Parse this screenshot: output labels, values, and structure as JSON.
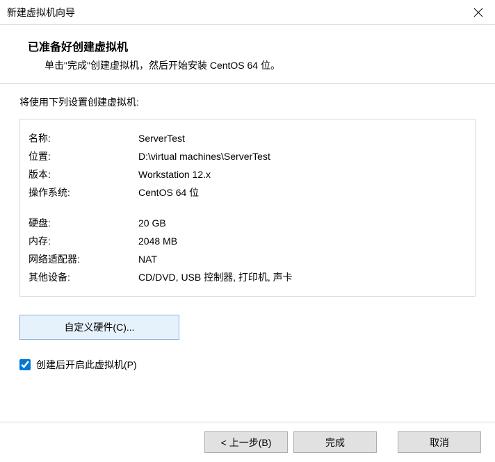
{
  "window": {
    "title": "新建虚拟机向导"
  },
  "header": {
    "title": "已准备好创建虚拟机",
    "subtitle": "单击\"完成\"创建虚拟机，然后开始安装 CentOS 64 位。"
  },
  "intro": "将使用下列设置创建虚拟机:",
  "settings": {
    "rows": [
      {
        "label": "名称:",
        "value": "ServerTest"
      },
      {
        "label": "位置:",
        "value": "D:\\virtual machines\\ServerTest"
      },
      {
        "label": "版本:",
        "value": "Workstation 12.x"
      },
      {
        "label": "操作系统:",
        "value": "CentOS 64 位"
      }
    ],
    "rows2": [
      {
        "label": "硬盘:",
        "value": "20 GB"
      },
      {
        "label": "内存:",
        "value": "2048 MB"
      },
      {
        "label": "网络适配器:",
        "value": "NAT"
      },
      {
        "label": "其他设备:",
        "value": "CD/DVD, USB 控制器, 打印机, 声卡"
      }
    ]
  },
  "buttons": {
    "customize": "自定义硬件(C)...",
    "back": "< 上一步(B)",
    "finish": "完成",
    "cancel": "取消"
  },
  "checkbox": {
    "label": "创建后开启此虚拟机(P)",
    "checked": true
  }
}
